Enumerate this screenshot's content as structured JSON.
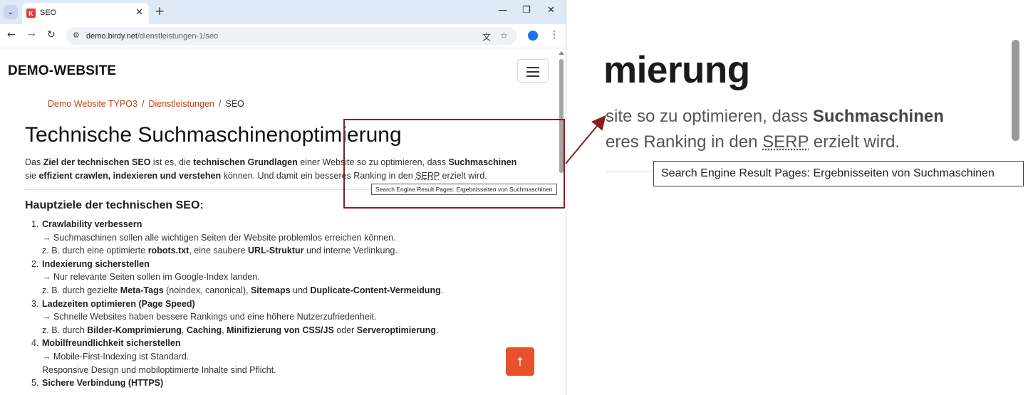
{
  "browser": {
    "tab_title": "SEO",
    "favicon_letter": "K",
    "url_host": "demo.birdy.net",
    "url_path": "/dienstleistungen-1/seo"
  },
  "page": {
    "brand": "DEMO-WEBSITE",
    "breadcrumb": [
      "Demo Website TYPO3",
      "Dienstleistungen",
      "SEO"
    ],
    "title": "Technische Suchmaschinenoptimierung",
    "intro": {
      "t1": "Das ",
      "b1": "Ziel der technischen SEO",
      "t2": " ist es, die ",
      "b2": "technischen Grundlagen",
      "t3": " einer Website so zu optimieren, dass ",
      "b3": "Suchmaschinen",
      "t4": " sie ",
      "b4": "effizient crawlen, indexieren und verstehen",
      "t5": " können. Und damit ein besseres Ranking in den ",
      "abbr": "SERP",
      "t6": " erzielt wird."
    },
    "section_title": "Hauptziele der technischen SEO:",
    "items": [
      {
        "num": "1.",
        "title": "Crawlability verbessern",
        "line1": "→ Suchmaschinen sollen alle wichtigen Seiten der Website problemlos erreichen können.",
        "l2a": "z. B. durch eine optimierte ",
        "l2b": "robots.txt",
        "l2c": ", eine saubere ",
        "l2d": "URL-Struktur",
        "l2e": " und interne Verlinkung."
      },
      {
        "num": "2.",
        "title": "Indexierung sicherstellen",
        "line1": "→ Nur relevante Seiten sollen im Google-Index landen.",
        "l2a": "z. B. durch gezielte ",
        "l2b": "Meta-Tags",
        "l2c": " (noindex, canonical), ",
        "l2d": "Sitemaps",
        "l2e": " und ",
        "l2f": "Duplicate-Content-Vermeidung",
        "l2g": "."
      },
      {
        "num": "3.",
        "title": "Ladezeiten optimieren (Page Speed)",
        "line1": "→ Schnelle Websites haben bessere Rankings und eine höhere Nutzerzufriedenheit.",
        "l2a": "z. B. durch ",
        "l2b": "Bilder-Komprimierung",
        "l2c": ", ",
        "l2d": "Caching",
        "l2e": ", ",
        "l2f": "Minifizierung von CSS/JS",
        "l2g": " oder ",
        "l2h": "Serveroptimierung",
        "l2i": "."
      },
      {
        "num": "4.",
        "title": "Mobilfreundlichkeit sicherstellen",
        "line1": "→ Mobile-First-Indexing ist Standard.",
        "line2": "Responsive Design und mobiloptimierte Inhalte sind Pflicht."
      },
      {
        "num": "5.",
        "title": "Sichere Verbindung (HTTPS)"
      }
    ],
    "tooltip": "Search Engine Result Pages: Ergebnisseiten von Suchmaschinen",
    "to_top_icon": "arrow-up-icon"
  },
  "zoom": {
    "heading_fragment": "mierung",
    "line1_text": "site so zu optimieren, dass ",
    "line1_bold": "Suchmaschinen",
    "line2_pre": "eres Ranking in den ",
    "line2_abbr": "SERP",
    "line2_post": " erzielt wird.",
    "tooltip": "Search Engine Result Pages: Ergebnisseiten von Suchmaschinen"
  },
  "colors": {
    "link": "#c2410c",
    "accent_button": "#e8512c",
    "highlight": "#8b1d1d",
    "tabstrip": "#dfe9f8"
  }
}
